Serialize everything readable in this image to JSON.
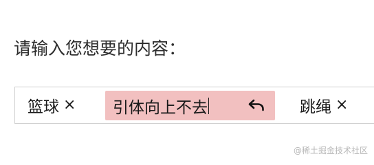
{
  "prompt": {
    "label": "请输入您想要的内容："
  },
  "tags": [
    {
      "label": "篮球",
      "remove": "×"
    },
    {
      "label": "引体向上不去",
      "editing": true
    },
    {
      "label": "跳绳",
      "remove": "×"
    }
  ],
  "colors": {
    "editing_tag_bg": "#f2c0c0",
    "input_border": "#cfcfcf"
  },
  "icons": {
    "undo": "undo-icon"
  },
  "watermark": {
    "text": "@稀土掘金技术社区"
  }
}
